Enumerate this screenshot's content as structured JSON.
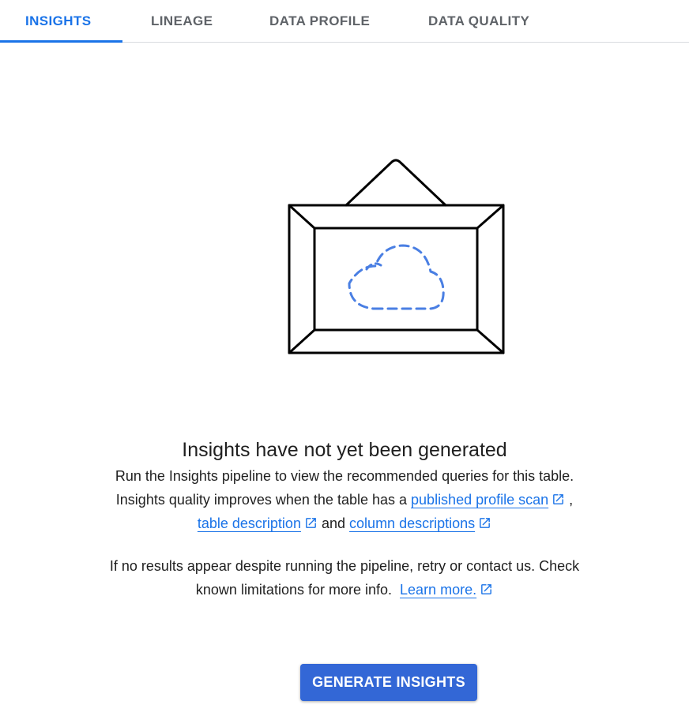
{
  "tabs": [
    {
      "label": "INSIGHTS",
      "active": true
    },
    {
      "label": "LINEAGE",
      "active": false
    },
    {
      "label": "DATA PROFILE",
      "active": false
    },
    {
      "label": "DATA QUALITY",
      "active": false
    }
  ],
  "empty_state": {
    "illustration_icon": "picture-frame-cloud-icon",
    "title": "Insights have not yet been generated",
    "line1": "Run the Insights pipeline to view the recommended queries for this table.",
    "line2_prefix": "Insights quality improves when the table has a",
    "link_profile": "published profile scan",
    "line2_suffix": ",",
    "link_table_description": "table description",
    "and_text": "and",
    "link_column_descriptions": "column descriptions",
    "note_line1": "If no results appear despite running the pipeline, retry or contact us. Check",
    "note_line2": "known limitations for more info.",
    "link_learn_more": "Learn more."
  },
  "button": {
    "label": "GENERATE INSIGHTS"
  },
  "colors": {
    "accent": "#1a73e8",
    "button": "#3367d6",
    "text": "#1f1f1f",
    "tab_inactive": "#5f6368"
  },
  "icons": {
    "external_link": "open-in-new-icon"
  }
}
